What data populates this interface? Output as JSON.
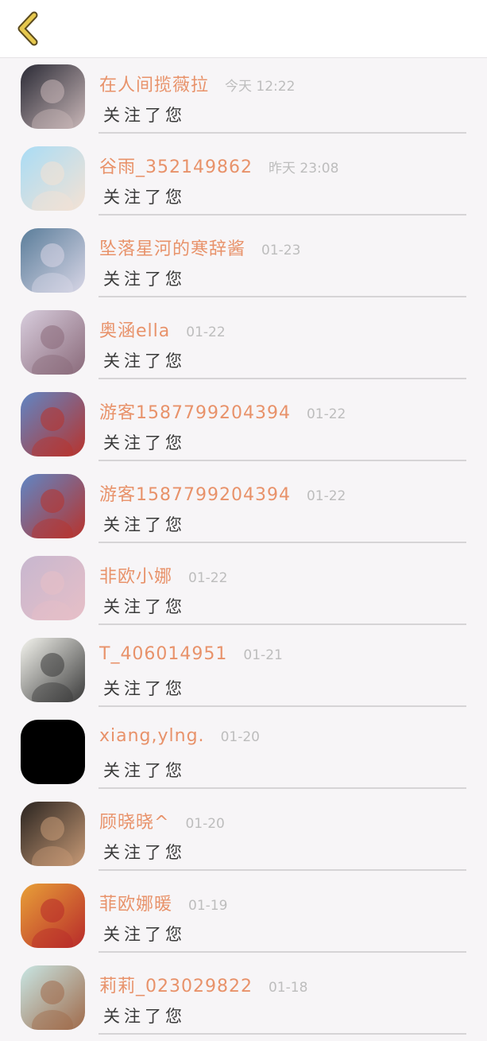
{
  "header": {
    "back_icon": "chevron-left-icon",
    "accent": "#e0c04a"
  },
  "colors": {
    "name": "#e8926a",
    "time": "#bdbdbd",
    "action": "#3a3a3a"
  },
  "notifications": [
    {
      "name": "在人间揽薇拉",
      "time": "今天 12:22",
      "action": "关注了您",
      "avatar": [
        "#2a2a35",
        "#c9b7b8"
      ]
    },
    {
      "name": "谷雨_352149862",
      "time": "昨天 23:08",
      "action": "关注了您",
      "avatar": [
        "#a9dcf5",
        "#f4e2d4"
      ]
    },
    {
      "name": "坠落星河的寒辞酱",
      "time": "01-23",
      "action": "关注了您",
      "avatar": [
        "#5a7d9a",
        "#d8d6e6"
      ]
    },
    {
      "name": "奥涵ella",
      "time": "01-22",
      "action": "关注了您",
      "avatar": [
        "#d8cddd",
        "#8a6a7a"
      ]
    },
    {
      "name": "游客1587799204394",
      "time": "01-22",
      "action": "关注了您",
      "avatar": [
        "#5f86c5",
        "#b8332c"
      ]
    },
    {
      "name": "游客1587799204394",
      "time": "01-22",
      "action": "关注了您",
      "avatar": [
        "#5f86c5",
        "#b8332c"
      ]
    },
    {
      "name": "非欧小娜",
      "time": "01-22",
      "action": "关注了您",
      "avatar": [
        "#c7b7cf",
        "#e7bfc7"
      ]
    },
    {
      "name": "T_406014951",
      "time": "01-21",
      "action": "关注了您",
      "avatar": [
        "#f4f4ee",
        "#3a3a3a"
      ]
    },
    {
      "name": "xiang,ylng.",
      "time": "01-20",
      "action": "关注了您",
      "avatar": [
        "#000000",
        "#000000"
      ]
    },
    {
      "name": "顾晓晓^",
      "time": "01-20",
      "action": "关注了您",
      "avatar": [
        "#2a2420",
        "#c79a76"
      ]
    },
    {
      "name": "菲欧娜暖",
      "time": "01-19",
      "action": "关注了您",
      "avatar": [
        "#e8a038",
        "#b82a2a"
      ]
    },
    {
      "name": "莉莉_023029822",
      "time": "01-18",
      "action": "关注了您",
      "avatar": [
        "#c8e6e4",
        "#a06a4a"
      ]
    }
  ]
}
